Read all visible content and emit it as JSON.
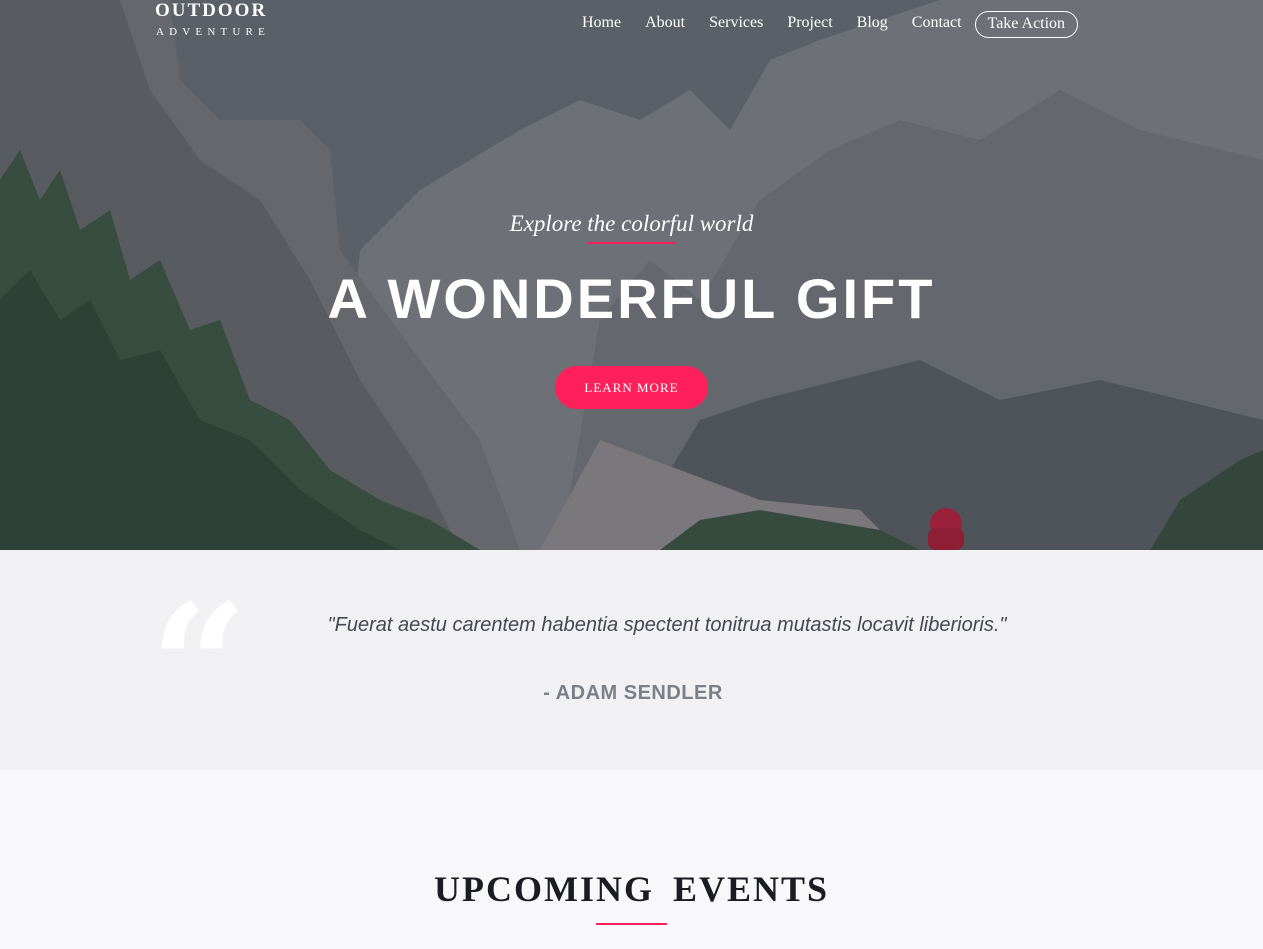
{
  "logo": {
    "main": "OUTDOOR",
    "sub": "ADVENTURE"
  },
  "nav": {
    "items": [
      "Home",
      "About",
      "Services",
      "Project",
      "Blog",
      "Contact"
    ],
    "cta": "Take Action"
  },
  "hero": {
    "tagline": "Explore the colorful world",
    "headline": "A WONDERFUL GIFT",
    "button": "LEARN MORE"
  },
  "quote": {
    "mark": "“",
    "text": "\"Fuerat aestu carentem habentia spectent tonitrua mutastis locavit liberioris.\"",
    "author": "- ADAM SENDLER"
  },
  "events": {
    "title": "UPCOMING EVENTS"
  },
  "colors": {
    "accent": "#ff1f5a",
    "quote_bg": "#f1f1f3",
    "page_bg": "#f8f8fa"
  }
}
